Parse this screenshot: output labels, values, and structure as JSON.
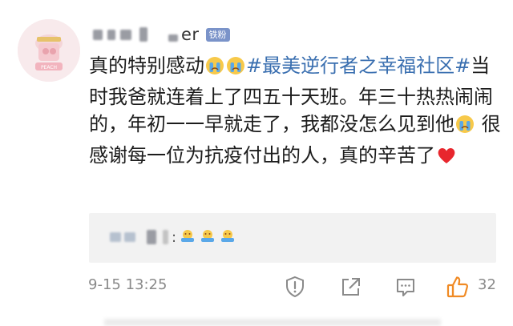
{
  "comment": {
    "username_visible_suffix": "er",
    "badge_label": "铁粉",
    "text_part1": "真的特别感动",
    "hashtag": "#最美逆行者之幸福社区#",
    "text_part2": "当时我爸就连着上了四五十天班。年三十热热闹闹的，年初一一早就走了，我都没怎么见到他",
    "text_part3": "很感谢每一位为抗疫付出的人，真的辛苦了",
    "emojis": [
      "crying-face-emoji",
      "crying-face-emoji",
      "crying-face-emoji",
      "red-heart-emoji"
    ],
    "timestamp": "9-15 13:25",
    "like_count": "32"
  },
  "reply": {
    "separator": ":",
    "emojis": [
      "cheering-emoji",
      "cheering-emoji",
      "cheering-emoji"
    ]
  },
  "colors": {
    "hashtag": "#3a6fb0",
    "badge": "#7a93c9",
    "like": "#f08a24",
    "meta": "#8a8a8a",
    "reply_bg": "#f2f2f2"
  },
  "icons": [
    "report-icon",
    "share-icon",
    "comment-icon",
    "like-icon"
  ]
}
